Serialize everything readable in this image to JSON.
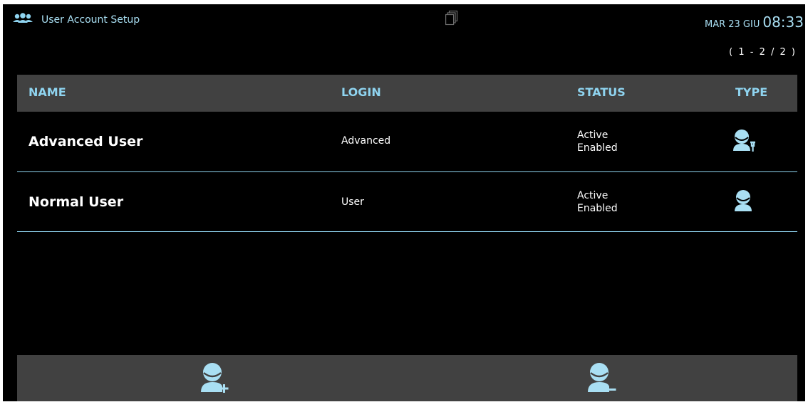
{
  "header": {
    "title": "User Account Setup",
    "title_icon": "users-group-icon",
    "center_icon": "copy-pages-icon",
    "date": "MAR 23 GIU",
    "time": "08:33",
    "pager": "( 1 - 2 / 2 )"
  },
  "table": {
    "columns": [
      "NAME",
      "LOGIN",
      "STATUS",
      "TYPE"
    ],
    "rows": [
      {
        "name": "Advanced User",
        "login": "Advanced",
        "status_line1": "Active",
        "status_line2": "Enabled",
        "type_icon": "advanced-user-icon"
      },
      {
        "name": "Normal User",
        "login": "User",
        "status_line1": "Active",
        "status_line2": "Enabled",
        "type_icon": "normal-user-icon"
      }
    ]
  },
  "toolbar": {
    "add_icon": "add-user-icon",
    "remove_icon": "remove-user-icon"
  },
  "colors": {
    "accent": "#8fd4f0",
    "background": "#000000",
    "header_bar": "#414141",
    "text": "#ffffff"
  }
}
